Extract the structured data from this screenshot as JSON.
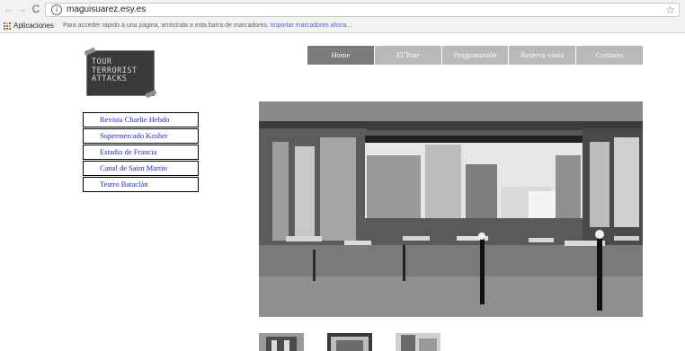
{
  "browser": {
    "url": "maguisuarez.esy.es",
    "back_glyph": "←",
    "forward_glyph": "→",
    "reload_glyph": "C",
    "info_glyph": "i",
    "star_glyph": "☆"
  },
  "bookmarks_bar": {
    "apps_label": "Aplicaciones",
    "hint": "Para acceder rápido a una página, arrástrala a esta barra de marcadores.",
    "import_link": "Importar marcadores ahora...",
    "apps_colors": [
      "#db4437",
      "#f4b400",
      "#0f9d58",
      "#4285f4",
      "#db4437",
      "#f4b400",
      "#0f9d58",
      "#4285f4",
      "#db4437"
    ]
  },
  "logo": {
    "text": "TOUR\nTERRORIST\nATTACKS"
  },
  "menu": {
    "items": [
      {
        "label": "Home",
        "active": true
      },
      {
        "label": "El Tour",
        "active": false
      },
      {
        "label": "Programación",
        "active": false
      },
      {
        "label": "Reserva visita",
        "active": false
      },
      {
        "label": "Contacto",
        "active": false
      }
    ]
  },
  "sidebar": {
    "items": [
      {
        "label": "Revista Charlie Hebdo"
      },
      {
        "label": "Supermercado Kosher"
      },
      {
        "label": "Estadio de Francia"
      },
      {
        "label": "Canal de Saint Martin"
      },
      {
        "label": "Teatro Bataclán"
      }
    ]
  },
  "colors": {
    "menu_active": "#7c7c7c",
    "menu_inactive": "#b9b9b9",
    "sidebar_link": "#1f1fcf"
  }
}
